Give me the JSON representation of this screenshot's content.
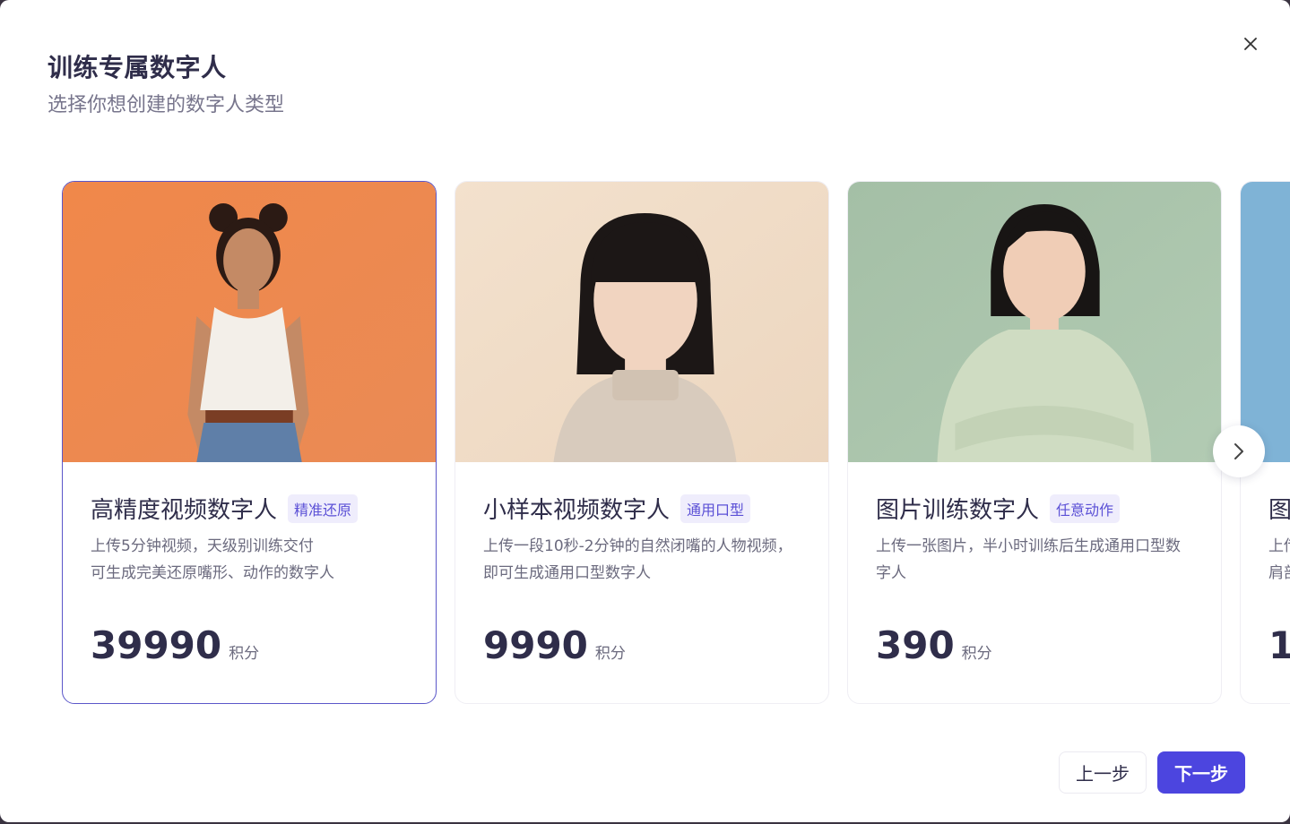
{
  "dialog": {
    "title": "训练专属数字人",
    "subtitle": "选择你想创建的数字人类型",
    "close_icon": "close-icon"
  },
  "cards": [
    {
      "title": "高精度视频数字人",
      "tag": "精准还原",
      "description": "上传5分钟视频，天级别训练交付\n可生成完美还原嘴形、动作的数字人",
      "price": "39990",
      "unit": "积分",
      "selected": true,
      "bg": "#ee8c4f"
    },
    {
      "title": "小样本视频数字人",
      "tag": "通用口型",
      "description": "上传一段10秒-2分钟的自然闭嘴的人物视频，即可生成通用口型数字人",
      "price": "9990",
      "unit": "积分",
      "selected": false,
      "bg": "#f1dcc6"
    },
    {
      "title": "图片训练数字人",
      "tag": "任意动作",
      "description": "上传一张图片，半小时训练后生成通用口型数字人",
      "price": "390",
      "unit": "积分",
      "selected": false,
      "bg": "#a9c3a9"
    },
    {
      "title": "图",
      "description": "上传\n肩部",
      "price": "1",
      "bg": "#7fb3d6"
    }
  ],
  "footer": {
    "prev_label": "上一步",
    "next_label": "下一步"
  },
  "colors": {
    "accent": "#4c45df",
    "selected_border": "#5b57c9",
    "tag_bg": "#efedfc",
    "tag_text": "#5b50d6"
  }
}
